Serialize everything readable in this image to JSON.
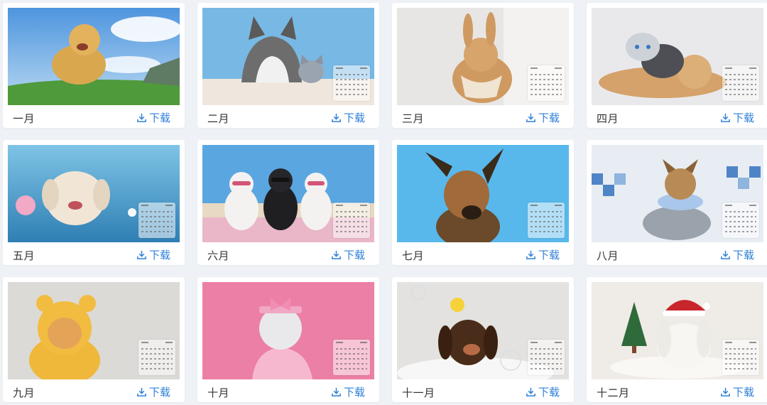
{
  "colors": {
    "accent": "#2f80d8",
    "background": "#eef1f5",
    "card": "#ffffff",
    "month_text": "#333333"
  },
  "download_icon": "download-icon",
  "cards": [
    {
      "month": "一月",
      "download_label": "下载",
      "image": "golden-retriever-running-grass-photo"
    },
    {
      "month": "二月",
      "download_label": "下载",
      "image": "husky-and-kitten-blue-background-photo"
    },
    {
      "month": "三月",
      "download_label": "下载",
      "image": "rabbit-with-bow-photo"
    },
    {
      "month": "四月",
      "download_label": "下载",
      "image": "three-cats-pile-photo"
    },
    {
      "month": "五月",
      "download_label": "下载",
      "image": "fluffy-dog-underwater-photo"
    },
    {
      "month": "六月",
      "download_label": "下载",
      "image": "three-french-bulldogs-sunglasses-beach-photo"
    },
    {
      "month": "七月",
      "download_label": "下载",
      "image": "german-shepherd-blue-background-photo"
    },
    {
      "month": "八月",
      "download_label": "下载",
      "image": "yorkshire-terrier-blue-tiles-photo"
    },
    {
      "month": "九月",
      "download_label": "下载",
      "image": "cat-in-bear-hoodie-photo"
    },
    {
      "month": "十月",
      "download_label": "下载",
      "image": "cat-with-pink-bow-photo"
    },
    {
      "month": "十一月",
      "download_label": "下载",
      "image": "dachshund-in-bathtub-with-duck-photo"
    },
    {
      "month": "十二月",
      "download_label": "下载",
      "image": "white-rabbit-santa-hat-photo"
    }
  ]
}
